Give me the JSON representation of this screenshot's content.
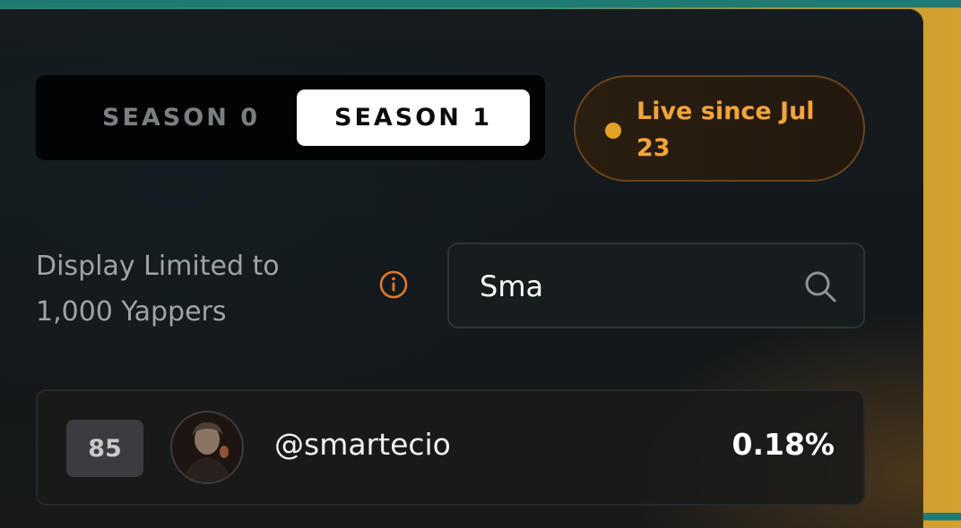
{
  "season_tabs": [
    {
      "label": "SEASON 0",
      "active": false
    },
    {
      "label": "SEASON 1",
      "active": true
    }
  ],
  "live_badge": {
    "text": "Live since Jul 23",
    "color": "#f2a43c",
    "dot_color": "#e2a326"
  },
  "display_limit": {
    "text": "Display Limited to 1,000 Yappers",
    "icon": "info-icon",
    "icon_color": "#e07a2a"
  },
  "search": {
    "value": "Sma",
    "placeholder": "",
    "icon": "search-icon"
  },
  "results": [
    {
      "rank": "85",
      "handle": "@smartecio",
      "share": "0.18%",
      "avatar": "avatar-portrait"
    }
  ],
  "colors": {
    "panel": "#151b1e",
    "accent": "#f2a43c",
    "active_tab_bg": "#ffffff",
    "inactive_tab_text": "#7a7f83"
  }
}
